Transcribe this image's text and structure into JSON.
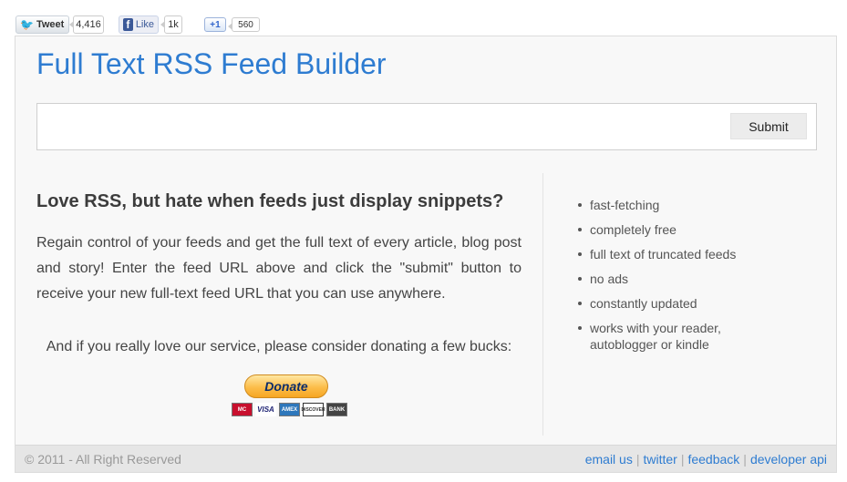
{
  "social": {
    "tweet_label": "Tweet",
    "tweet_count": "4,416",
    "like_label": "Like",
    "like_count": "1k",
    "plusone_label": "+1",
    "plusone_count": "560"
  },
  "page": {
    "title": "Full Text RSS Feed Builder"
  },
  "form": {
    "url_value": "",
    "submit_label": "Submit"
  },
  "intro": {
    "headline": "Love RSS, but hate when feeds just display snippets?",
    "body": "Regain control of your feeds and get the full text of every article, blog post and story! Enter the feed URL above and click the \"submit\" button to receive your new full-text feed URL that you can use anywhere.",
    "donate_text": "And if you really love our service, please consider donating a few bucks:",
    "donate_label": "Donate",
    "cards": [
      "mastercard-icon",
      "visa-icon",
      "amex-icon",
      "discover-icon",
      "bank-icon"
    ],
    "card_labels": {
      "mastercard": "MC",
      "visa": "VISA",
      "amex": "AMEX",
      "discover": "DISCOVER",
      "bank": "BANK"
    }
  },
  "features": [
    "fast-fetching",
    "completely free",
    "full text of truncated feeds",
    "no ads",
    "constantly updated",
    "works with your reader, autoblogger or kindle"
  ],
  "footer": {
    "copyright": "© 2011 - All Right Reserved",
    "links": [
      "email us",
      "twitter",
      "feedback",
      "developer api"
    ],
    "separator": "|"
  },
  "colors": {
    "accent": "#2e7cd1",
    "panel_bg": "#f8f8f8",
    "footer_bg": "#e6e6e6"
  }
}
